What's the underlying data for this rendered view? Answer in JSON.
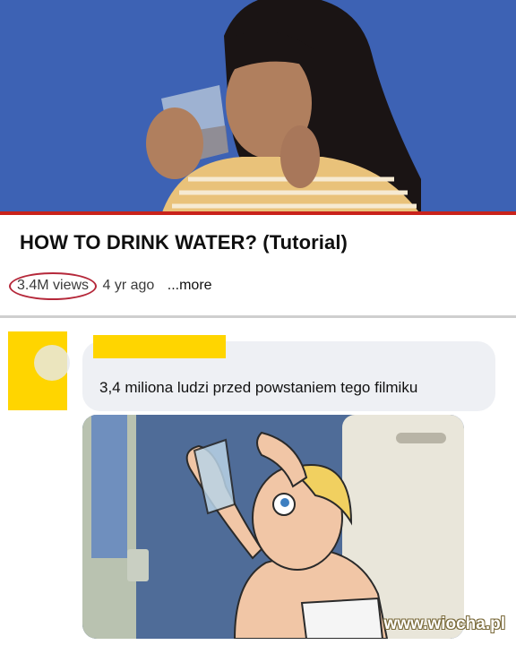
{
  "video": {
    "title": "HOW TO DRINK WATER? (Tutorial)",
    "views": "3.4M views",
    "age": "4 yr ago",
    "more": "...more"
  },
  "comment": {
    "text": "3,4 miliona ludzi przed powstaniem tego filmiku"
  },
  "watermark": "www.wiocha.pl",
  "colors": {
    "thumbnail_bg": "#3d62b4",
    "progress_red": "#c9221b",
    "redaction_yellow": "#ffd500",
    "bubble_bg": "#eef0f4"
  }
}
